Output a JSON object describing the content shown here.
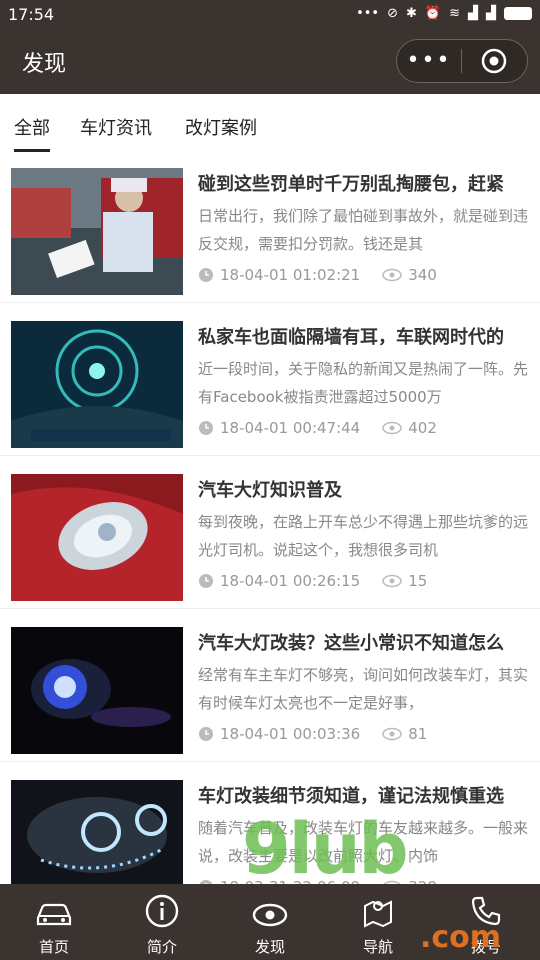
{
  "status": {
    "time": "17:54"
  },
  "header": {
    "title": "发现"
  },
  "tabs": [
    "全部",
    "车灯资讯",
    "改灯案例"
  ],
  "articles": [
    {
      "title": "碰到这些罚单时千万别乱掏腰包，赶紧",
      "desc": "日常出行，我们除了最怕碰到事故外，就是碰到违反交规，需要扣分罚款。钱还是其",
      "date": "18-04-01 01:02:21",
      "views": "340"
    },
    {
      "title": "私家车也面临隔墙有耳，车联网时代的",
      "desc": "近一段时间，关于隐私的新闻又是热闹了一阵。先有Facebook被指责泄露超过5000万",
      "date": "18-04-01 00:47:44",
      "views": "402"
    },
    {
      "title": "汽车大灯知识普及",
      "desc": "每到夜晚，在路上开车总少不得遇上那些坑爹的远光灯司机。说起这个，我想很多司机",
      "date": "18-04-01 00:26:15",
      "views": "15"
    },
    {
      "title": "汽车大灯改装？这些小常识不知道怎么",
      "desc": "经常有车主车灯不够亮，询问如何改装车灯，其实有时候车灯太亮也不一定是好事，",
      "date": "18-04-01 00:03:36",
      "views": "81"
    },
    {
      "title": "车灯改装细节须知道，谨记法规慎重选",
      "desc": "随着汽车普及，改装车灯的车友越来越多。一般来说，改装主要是以改前照大灯、内饰",
      "date": "18-03-31 22:06:09",
      "views": "328"
    }
  ],
  "tabbar": [
    "首页",
    "简介",
    "发现",
    "导航",
    "拨号"
  ],
  "watermark": {
    "main": "9lub",
    "suffix": ".com"
  }
}
